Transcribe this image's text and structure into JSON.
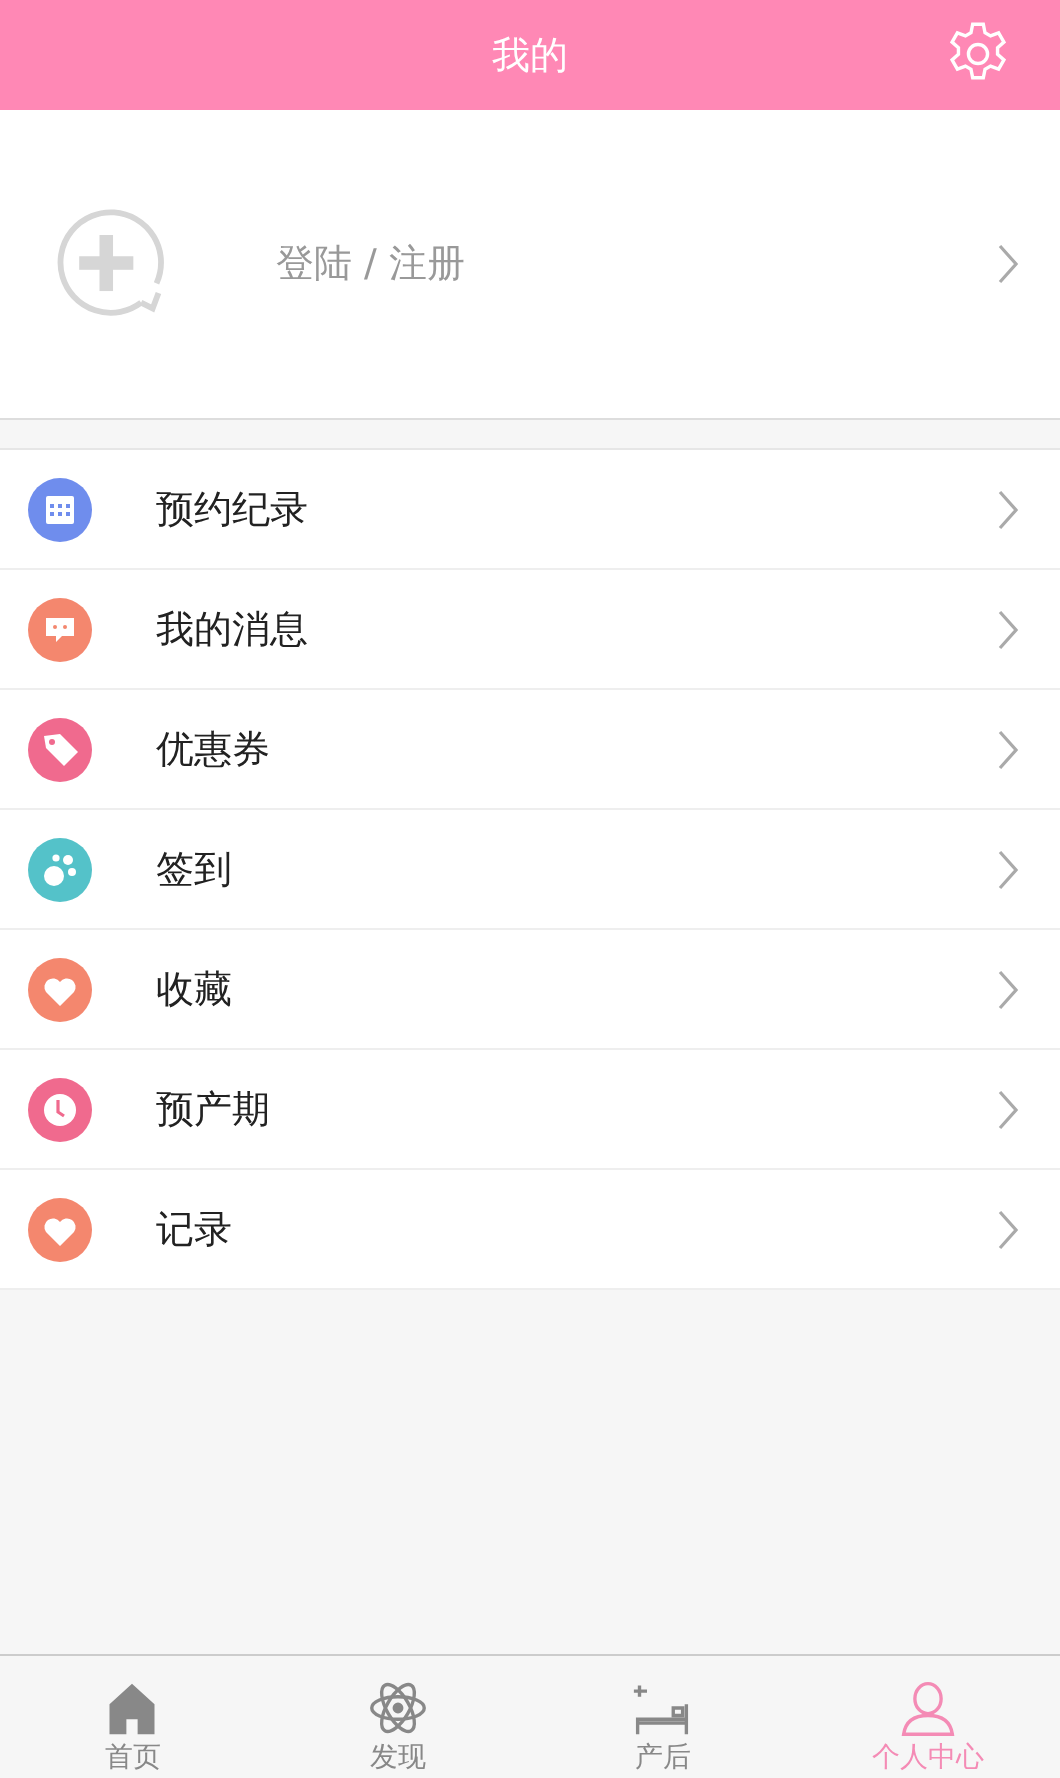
{
  "header": {
    "title": "我的"
  },
  "login": {
    "label": "登陆 / 注册"
  },
  "menu": [
    {
      "label": "预约纪录",
      "kind": "calendar",
      "color": "#6f8ded"
    },
    {
      "label": "我的消息",
      "kind": "message",
      "color": "#f4876e"
    },
    {
      "label": "优惠券",
      "kind": "tag",
      "color": "#f06a8e"
    },
    {
      "label": "签到",
      "kind": "paw",
      "color": "#54c2c9"
    },
    {
      "label": "收藏",
      "kind": "heart",
      "color": "#f4876e"
    },
    {
      "label": "预产期",
      "kind": "clock",
      "color": "#f06a8e"
    },
    {
      "label": "记录",
      "kind": "heart",
      "color": "#f4876e"
    }
  ],
  "tabs": [
    {
      "label": "首页",
      "kind": "home",
      "selected": false
    },
    {
      "label": "发现",
      "kind": "atom",
      "selected": false
    },
    {
      "label": "产后",
      "kind": "bed",
      "selected": false
    },
    {
      "label": "个人中心",
      "kind": "person",
      "selected": true
    }
  ]
}
